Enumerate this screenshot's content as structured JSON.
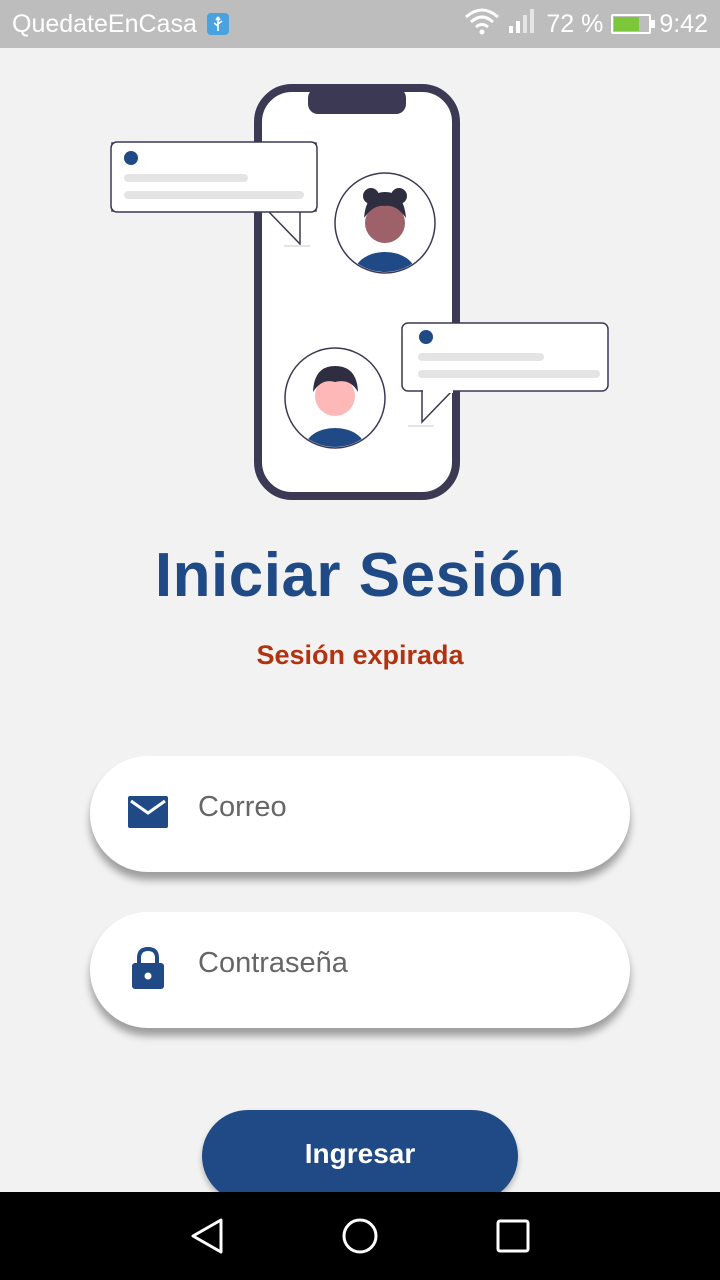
{
  "status_bar": {
    "app_name": "QuedateEnCasa",
    "battery_percent": "72 %",
    "battery_level": 0.72,
    "time": "9:42",
    "icons": [
      "usb-icon",
      "wifi-icon",
      "signal-icon",
      "battery-charging-icon"
    ]
  },
  "login": {
    "title": "Iniciar Sesión",
    "message": "Sesión expirada",
    "email_placeholder": "Correo",
    "password_placeholder": "Contraseña",
    "submit_label": "Ingresar"
  },
  "colors": {
    "primary": "#1f4a85",
    "error": "#b23310",
    "background": "#f2f2f2",
    "status_bar": "#bdbdbd"
  },
  "navigation": {
    "icons": [
      "back-icon",
      "home-icon",
      "recents-icon"
    ]
  }
}
